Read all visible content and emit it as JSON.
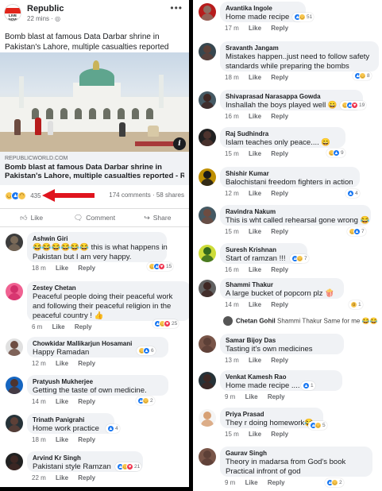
{
  "post": {
    "page_name": "Republic",
    "logo_text": "LIVE NOW",
    "time": "22 mins · ◎",
    "text": "Bomb blast at famous Data Darbar shrine in Pakistan's Lahore, multiple casualties reported",
    "link_domain": "REPUBLICWORLD.COM",
    "link_title_1": "Bomb blast at famous Data Darbar shrine in",
    "link_title_2": "Pakistan's Lahore, multiple casualties reported - Re...",
    "reaction_count": "435",
    "comments_shares": "174 comments · 58 shares",
    "actions": {
      "like": "Like",
      "comment": "Comment",
      "share": "Share"
    }
  },
  "comments_left": [
    {
      "author": "Ashwin Giri",
      "line1": "😂😂😂😂😂😂 this is what happens in",
      "line2": "Pakistan but I am very happy.",
      "time": "18 m",
      "like": "Like",
      "reply": "Reply",
      "count": "15"
    },
    {
      "author": "Zestey Chetan",
      "line1": "Peaceful people doing their peaceful work",
      "line2": "and following their  peaceful religion in the",
      "line3": "peaceful country ! 👍",
      "time": "6 m",
      "like": "Like",
      "reply": "Reply",
      "count": "25"
    },
    {
      "author": "Chowkidar Mallikarjun Hosamani",
      "line1": "Happy Ramadan",
      "time": "12 m",
      "like": "Like",
      "reply": "Reply",
      "count": "6"
    },
    {
      "author": "Pratyush Mukherjee",
      "line1": "Getting the taste of own medicine.",
      "time": "14 m",
      "like": "Like",
      "reply": "Reply",
      "count": "2"
    },
    {
      "author": "Trinath Panigrahi",
      "line1": "Home work practice",
      "time": "18 m",
      "like": "Like",
      "reply": "Reply",
      "count": "4"
    },
    {
      "author": "Arvind Kr Singh",
      "line1": "Pakistani style Ramzan",
      "time": "22 m",
      "like": "Like",
      "reply": "Reply",
      "count": "21"
    }
  ],
  "comments_right": [
    {
      "author": "Avantika Ingole",
      "line1": "Home made recipe",
      "time": "17 m",
      "like": "Like",
      "reply": "Reply",
      "count": "51"
    },
    {
      "author": "Sravanth Jangam",
      "line1": "Mistakes happen..just need to follow safety",
      "line2": "standards while preparing the bombs",
      "time": "18 m",
      "like": "Like",
      "reply": "Reply",
      "count": "8"
    },
    {
      "author": "Shivaprasad Narasappa Gowda",
      "line1": "Inshallah the boys played well 😀",
      "time": "16 m",
      "like": "Like",
      "reply": "Reply",
      "count": "19"
    },
    {
      "author": "Raj Sudhindra",
      "line1": "Islam teaches only peace.... 😄",
      "time": "15 m",
      "like": "Like",
      "reply": "Reply",
      "count": "9"
    },
    {
      "author": "Shishir Kumar",
      "line1": "Balochistani freedom fighters in action",
      "time": "12 m",
      "like": "Like",
      "reply": "Reply",
      "count": "4"
    },
    {
      "author": "Ravindra Nakum",
      "line1": "This is wht called rehearsal gone wrong 😂",
      "time": "15 m",
      "like": "Like",
      "reply": "Reply",
      "count": "7"
    },
    {
      "author": "Suresh Krishnan",
      "line1": "Start of ramzan  !!!",
      "time": "16 m",
      "like": "Like",
      "reply": "Reply",
      "count": "7"
    },
    {
      "author": "Shammi Thakur",
      "line1": "A large bucket of popcorn plz 🍿",
      "time": "14 m",
      "like": "Like",
      "reply": "Reply",
      "count": "1"
    },
    {
      "author": "Samar Bijoy Das",
      "line1": "Tasting it's own medicines",
      "time": "13 m",
      "like": "Like",
      "reply": "Reply"
    },
    {
      "author": "Venkat Kamesh Rao",
      "line1": "Home made recipe ....",
      "time": "9 m",
      "like": "Like",
      "reply": "Reply",
      "count": "1"
    },
    {
      "author": "Priya Prasad",
      "line1": "They r doing homework😂",
      "time": "15 m",
      "like": "Like",
      "reply": "Reply",
      "count": "5"
    },
    {
      "author": "Gaurav Singh",
      "line1": "Theory in madarsa from God's book",
      "line2": "Practical infront of god",
      "time": "9 m",
      "like": "Like",
      "reply": "Reply",
      "count": "2"
    }
  ],
  "reply": {
    "author": "Chetan Gohil",
    "text": "Shammi Thakur Same for me 😂😂"
  },
  "colors": {
    "accent": "#1877f2",
    "arrow": "#e0141e",
    "bubble": "#f0f2f5",
    "meta": "#65676b"
  }
}
